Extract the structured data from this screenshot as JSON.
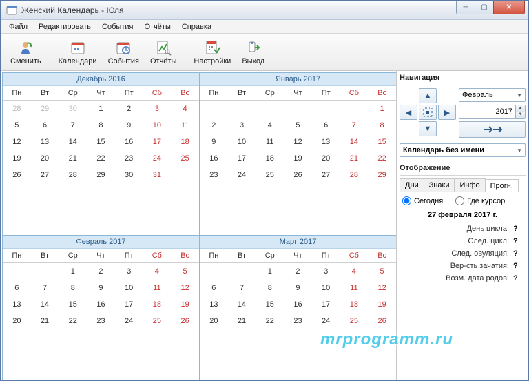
{
  "window": {
    "title": "Женский Календарь - Юля"
  },
  "menu": [
    "Файл",
    "Редактировать",
    "События",
    "Отчёты",
    "Справка"
  ],
  "toolbar": [
    {
      "label": "Сменить"
    },
    {
      "label": "Календари"
    },
    {
      "label": "События"
    },
    {
      "label": "Отчёты"
    },
    {
      "label": "Настройки"
    },
    {
      "label": "Выход"
    }
  ],
  "dow": [
    "Пн",
    "Вт",
    "Ср",
    "Чт",
    "Пт",
    "Сб",
    "Вс"
  ],
  "months": [
    {
      "title": "Декабрь  2016",
      "weeks": [
        [
          {
            "d": "28",
            "o": 1
          },
          {
            "d": "29",
            "o": 1
          },
          {
            "d": "30",
            "o": 1
          },
          {
            "d": "1"
          },
          {
            "d": "2"
          },
          {
            "d": "3",
            "w": 1
          },
          {
            "d": "4",
            "w": 1
          }
        ],
        [
          {
            "d": "5"
          },
          {
            "d": "6"
          },
          {
            "d": "7"
          },
          {
            "d": "8"
          },
          {
            "d": "9"
          },
          {
            "d": "10",
            "w": 1
          },
          {
            "d": "11",
            "w": 1
          }
        ],
        [
          {
            "d": "12"
          },
          {
            "d": "13"
          },
          {
            "d": "14"
          },
          {
            "d": "15"
          },
          {
            "d": "16"
          },
          {
            "d": "17",
            "w": 1
          },
          {
            "d": "18",
            "w": 1
          }
        ],
        [
          {
            "d": "19"
          },
          {
            "d": "20"
          },
          {
            "d": "21"
          },
          {
            "d": "22"
          },
          {
            "d": "23"
          },
          {
            "d": "24",
            "w": 1
          },
          {
            "d": "25",
            "w": 1
          }
        ],
        [
          {
            "d": "26"
          },
          {
            "d": "27"
          },
          {
            "d": "28"
          },
          {
            "d": "29"
          },
          {
            "d": "30"
          },
          {
            "d": "31",
            "w": 1
          },
          {
            "d": ""
          }
        ]
      ]
    },
    {
      "title": "Январь  2017",
      "weeks": [
        [
          {
            "d": ""
          },
          {
            "d": ""
          },
          {
            "d": ""
          },
          {
            "d": ""
          },
          {
            "d": ""
          },
          {
            "d": ""
          },
          {
            "d": "1",
            "w": 1
          }
        ],
        [
          {
            "d": "2"
          },
          {
            "d": "3"
          },
          {
            "d": "4"
          },
          {
            "d": "5"
          },
          {
            "d": "6"
          },
          {
            "d": "7",
            "w": 1
          },
          {
            "d": "8",
            "w": 1
          }
        ],
        [
          {
            "d": "9"
          },
          {
            "d": "10"
          },
          {
            "d": "11"
          },
          {
            "d": "12"
          },
          {
            "d": "13"
          },
          {
            "d": "14",
            "w": 1
          },
          {
            "d": "15",
            "w": 1
          }
        ],
        [
          {
            "d": "16"
          },
          {
            "d": "17"
          },
          {
            "d": "18"
          },
          {
            "d": "19"
          },
          {
            "d": "20"
          },
          {
            "d": "21",
            "w": 1
          },
          {
            "d": "22",
            "w": 1
          }
        ],
        [
          {
            "d": "23"
          },
          {
            "d": "24"
          },
          {
            "d": "25"
          },
          {
            "d": "26"
          },
          {
            "d": "27"
          },
          {
            "d": "28",
            "w": 1
          },
          {
            "d": "29",
            "w": 1
          }
        ]
      ]
    },
    {
      "title": "Февраль  2017",
      "weeks": [
        [
          {
            "d": ""
          },
          {
            "d": ""
          },
          {
            "d": "1"
          },
          {
            "d": "2"
          },
          {
            "d": "3"
          },
          {
            "d": "4",
            "w": 1
          },
          {
            "d": "5",
            "w": 1
          }
        ],
        [
          {
            "d": "6"
          },
          {
            "d": "7"
          },
          {
            "d": "8"
          },
          {
            "d": "9"
          },
          {
            "d": "10"
          },
          {
            "d": "11",
            "w": 1
          },
          {
            "d": "12",
            "w": 1
          }
        ],
        [
          {
            "d": "13"
          },
          {
            "d": "14"
          },
          {
            "d": "15"
          },
          {
            "d": "16"
          },
          {
            "d": "17"
          },
          {
            "d": "18",
            "w": 1
          },
          {
            "d": "19",
            "w": 1
          }
        ],
        [
          {
            "d": "20"
          },
          {
            "d": "21"
          },
          {
            "d": "22"
          },
          {
            "d": "23"
          },
          {
            "d": "24"
          },
          {
            "d": "25",
            "w": 1
          },
          {
            "d": "26",
            "w": 1
          }
        ]
      ]
    },
    {
      "title": "Март  2017",
      "weeks": [
        [
          {
            "d": ""
          },
          {
            "d": ""
          },
          {
            "d": "1"
          },
          {
            "d": "2"
          },
          {
            "d": "3"
          },
          {
            "d": "4",
            "w": 1
          },
          {
            "d": "5",
            "w": 1
          }
        ],
        [
          {
            "d": "6"
          },
          {
            "d": "7"
          },
          {
            "d": "8"
          },
          {
            "d": "9"
          },
          {
            "d": "10"
          },
          {
            "d": "11",
            "w": 1
          },
          {
            "d": "12",
            "w": 1
          }
        ],
        [
          {
            "d": "13"
          },
          {
            "d": "14"
          },
          {
            "d": "15"
          },
          {
            "d": "16"
          },
          {
            "d": "17"
          },
          {
            "d": "18",
            "w": 1
          },
          {
            "d": "19",
            "w": 1
          }
        ],
        [
          {
            "d": "20"
          },
          {
            "d": "21"
          },
          {
            "d": "22"
          },
          {
            "d": "23"
          },
          {
            "d": "24"
          },
          {
            "d": "25",
            "w": 1
          },
          {
            "d": "26",
            "w": 1
          }
        ]
      ]
    }
  ],
  "nav": {
    "title": "Навигация",
    "month": "Февраль",
    "year": "2017"
  },
  "calcombo": "Календарь без имени",
  "display": {
    "title": "Отображение",
    "tabs": [
      "Дни",
      "Знаки",
      "Инфо",
      "Прогн."
    ],
    "radio_today": "Сегодня",
    "radio_cursor": "Где курсор",
    "date": "27 февраля 2017 г.",
    "rows": [
      {
        "label": "День цикла:",
        "value": "?"
      },
      {
        "label": "След. цикл:",
        "value": "?"
      },
      {
        "label": "След. овуляция:",
        "value": "?"
      },
      {
        "label": "Вер-сть зачатия:",
        "value": "?"
      },
      {
        "label": "Возм. дата родов:",
        "value": "?"
      }
    ]
  },
  "watermark": "mrprogramm.ru"
}
